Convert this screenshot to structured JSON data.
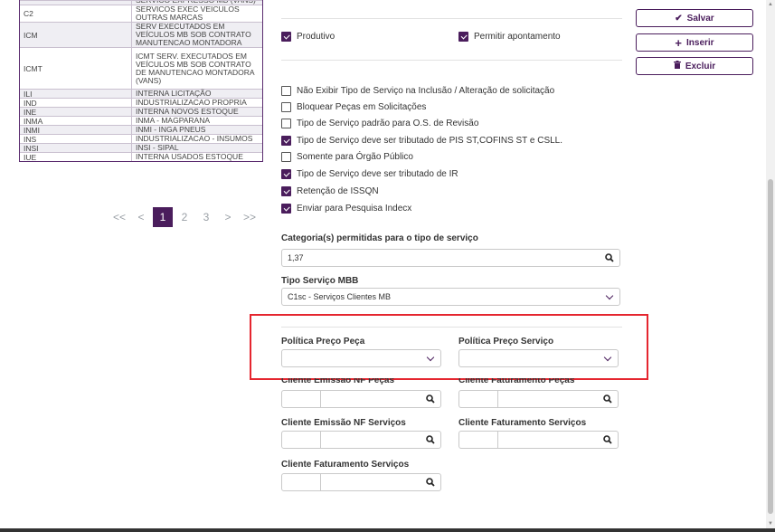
{
  "table": {
    "rows": [
      {
        "code": "",
        "desc": "SERVICO EXPRESSO MB (VANS)",
        "clip": true
      },
      {
        "code": "C2",
        "desc": "SERVICOS EXEC VEICULOS OUTRAS MARCAS",
        "h": 19
      },
      {
        "code": "ICM",
        "desc": "SERV EXECUTADOS EM VEÍCULOS MB SOB CONTRATO MANUTENCAO MONTADORA",
        "h": 28
      },
      {
        "code": "ICMT",
        "desc": "ICMT SERV. EXECUTADOS EM VEÍCULOS MB SOB CONTRATO DE MANUTENCAO MONTADORA (VANS)",
        "h": 46
      },
      {
        "code": "ILI",
        "desc": "INTERNA LICITAÇÃO",
        "h": 10
      },
      {
        "code": "IND",
        "desc": "INDUSTRIALIZACAO PROPRIA",
        "h": 10
      },
      {
        "code": "INE",
        "desc": "INTERNA NOVOS ESTOQUE",
        "h": 10
      },
      {
        "code": "INMA",
        "desc": "INMA - MAGPARANA",
        "h": 10
      },
      {
        "code": "INMI",
        "desc": "INMI - INGA PNEUS",
        "h": 10
      },
      {
        "code": "INS",
        "desc": "INDUSTRIALIZACAO - INSUMOS",
        "h": 10
      },
      {
        "code": "INSI",
        "desc": "INSI - SIPAL",
        "h": 10
      },
      {
        "code": "IUE",
        "desc": "INTERNA USADOS ESTOQUE",
        "h": 10
      }
    ]
  },
  "pager": {
    "first": "<<",
    "prev": "<",
    "pages": [
      "1",
      "2",
      "3"
    ],
    "next": ">",
    "last": ">>",
    "current": "1"
  },
  "checks": {
    "produtivo": {
      "label": "Produtivo",
      "checked": true
    },
    "permitir": {
      "label": "Permitir apontamento",
      "checked": true
    },
    "list": [
      {
        "label": "Não Exibir Tipo de Serviço na Inclusão / Alteração de solicitação",
        "checked": false
      },
      {
        "label": "Bloquear Peças em Solicitações",
        "checked": false
      },
      {
        "label": "Tipo de Serviço padrão para O.S. de Revisão",
        "checked": false
      },
      {
        "label": "Tipo de Serviço deve ser tributado de PIS ST,COFINS ST e CSLL.",
        "checked": true
      },
      {
        "label": "Somente para Órgão Público",
        "checked": false
      },
      {
        "label": "Tipo de Serviço deve ser tributado de IR",
        "checked": true
      },
      {
        "label": "Retenção de ISSQN",
        "checked": true
      },
      {
        "label": "Enviar para Pesquisa Indecx",
        "checked": true
      }
    ]
  },
  "fields": {
    "categoria_label": "Categoria(s) permitidas para o tipo de serviço",
    "categoria_value": "1,37",
    "tipo_mbb_label": "Tipo Serviço MBB",
    "tipo_mbb_value": "C1sc - Serviços Clientes MB",
    "politica_peca_label": "Política Preço Peça",
    "politica_servico_label": "Política Preço Serviço",
    "cliente_emissao_pecas_label": "Cliente Emissão NF Peças",
    "cliente_fat_pecas_label": "Cliente Faturamento Peças",
    "cliente_emissao_serv_label": "Cliente Emissão NF Serviços",
    "cliente_fat_serv_label": "Cliente Faturamento Serviços",
    "cliente_fat_serv2_label": "Cliente Faturamento Serviços"
  },
  "buttons": {
    "salvar": "Salvar",
    "inserir": "Inserir",
    "excluir": "Excluir"
  },
  "colors": {
    "brand": "#4a1d5c",
    "highlight": "#e5262f"
  }
}
